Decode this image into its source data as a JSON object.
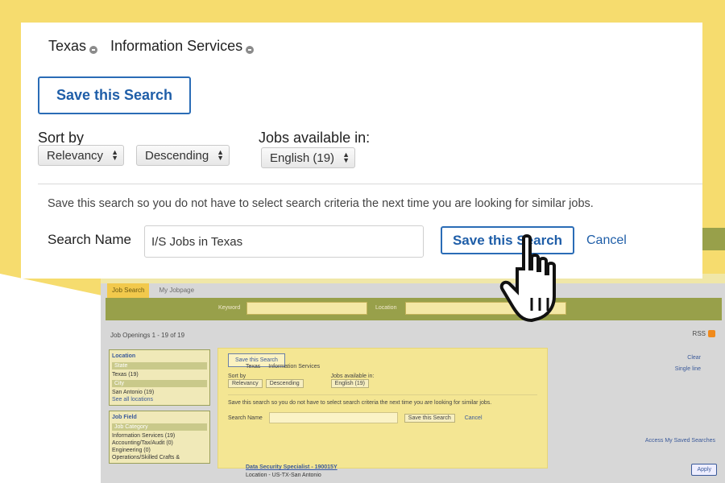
{
  "filters": {
    "chips": [
      "Texas",
      "Information Services"
    ]
  },
  "save_search_label": "Save this Search",
  "sort": {
    "label": "Sort by",
    "order_by": "Relevancy",
    "direction": "Descending"
  },
  "jobs_available": {
    "label": "Jobs available in:",
    "value": "English (19)"
  },
  "save_form": {
    "help_text": "Save this search so you do not have to select search criteria the next time you are looking for similar jobs.",
    "name_label": "Search Name",
    "name_value": "I/S Jobs in Texas",
    "save_label": "Save this Search",
    "cancel_label": "Cancel"
  },
  "background_page": {
    "tabs": [
      "Job Search",
      "My Jobpage"
    ],
    "keyword_label": "Keyword",
    "location_label": "Location",
    "openings_text": "Job Openings 1 - 19 of 19",
    "rss_label": "RSS",
    "clear_label": "Clear",
    "single_line_label": "Single line",
    "location_facet": {
      "title": "Location",
      "sub1": "State",
      "item1": "Texas (19)",
      "sub2": "City",
      "item2": "San Antonio (19)",
      "more": "See all locations"
    },
    "jobfield_facet": {
      "title": "Job Field",
      "sub": "Job Category",
      "items": [
        "Information Services (19)",
        "Accounting/Tax/Audit (0)",
        "Engineering (0)",
        "Operations/Skilled Crafts &"
      ]
    },
    "mini_chips": [
      "Texas",
      "Information Services"
    ],
    "mini_save_label": "Save this Search",
    "mini_sort_label": "Sort by",
    "mini_sort_values": [
      "Relevancy",
      "Descending"
    ],
    "mini_jobs_label": "Jobs available in:",
    "mini_jobs_value": "English (19)",
    "mini_help": "Save this search so you do not have to select search criteria the next time you are looking for similar jobs.",
    "mini_name_label": "Search Name",
    "mini_save_btn": "Save this Search",
    "mini_cancel": "Cancel",
    "access_saved": "Access My Saved Searches",
    "job_title": "Data Security Specialist - 190015Y",
    "job_location": "Location - US-TX-San Antonio",
    "apply_label": "Apply"
  },
  "icons": {
    "chip_remove": "remove-circle-icon",
    "pointer": "hand-pointer-icon",
    "rss": "rss-icon"
  },
  "colors": {
    "accent_blue": "#1f5ea8",
    "highlight_yellow": "#f6dc6e",
    "nav_green": "#98a04a"
  }
}
